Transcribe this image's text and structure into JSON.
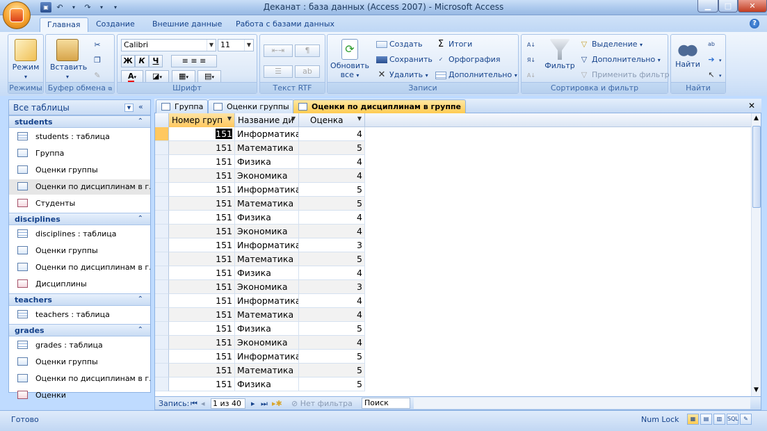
{
  "window": {
    "title": "Деканат : база данных (Access 2007)  -  Microsoft Access"
  },
  "ribbon_tabs": [
    "Главная",
    "Создание",
    "Внешние данные",
    "Работа с базами данных"
  ],
  "ribbon": {
    "groups": {
      "modes": "Режимы",
      "clipboard": "Буфер обмена",
      "font": "Шрифт",
      "rtf": "Текст RTF",
      "records": "Записи",
      "sort_filter": "Сортировка и фильтр",
      "find": "Найти"
    },
    "mode_btn": "Режим",
    "paste_btn": "Вставить",
    "font_name": "Calibri",
    "font_size": "11",
    "bold": "Ж",
    "italic": "К",
    "underline": "Ч",
    "refresh_btn": "Обновить",
    "refresh_btn2": "все",
    "new_btn": "Создать",
    "save_btn": "Сохранить",
    "delete_btn": "Удалить",
    "totals_btn": "Итоги",
    "spelling_btn": "Орфография",
    "more_btn": "Дополнительно",
    "filter_btn": "Фильтр",
    "selection_btn": "Выделение",
    "advanced_btn": "Дополнительно",
    "apply_filter_btn": "Применить фильтр",
    "find_btn": "Найти"
  },
  "nav": {
    "header": "Все таблицы",
    "sections": [
      {
        "title": "students",
        "items": [
          {
            "label": "students : таблица",
            "type": "table"
          },
          {
            "label": "Группа",
            "type": "query"
          },
          {
            "label": "Оценки группы",
            "type": "query"
          },
          {
            "label": "Оценки по дисциплинам в г...",
            "type": "query",
            "selected": true
          },
          {
            "label": "Студенты",
            "type": "form"
          }
        ]
      },
      {
        "title": "disciplines",
        "items": [
          {
            "label": "disciplines : таблица",
            "type": "table"
          },
          {
            "label": "Оценки группы",
            "type": "query"
          },
          {
            "label": "Оценки по дисциплинам в г...",
            "type": "query"
          },
          {
            "label": "Дисциплины",
            "type": "form"
          }
        ]
      },
      {
        "title": "teachers",
        "items": [
          {
            "label": "teachers : таблица",
            "type": "table"
          }
        ]
      },
      {
        "title": "grades",
        "items": [
          {
            "label": "grades : таблица",
            "type": "table"
          },
          {
            "label": "Оценки группы",
            "type": "query"
          },
          {
            "label": "Оценки по дисциплинам в г...",
            "type": "query"
          },
          {
            "label": "Оценки",
            "type": "form"
          }
        ]
      }
    ]
  },
  "doc_tabs": [
    "Группа",
    "Оценки группы",
    "Оценки по дисциплинам в группе"
  ],
  "datasheet": {
    "columns": [
      "Номер груп",
      "Название ди",
      "Оценка"
    ],
    "rows": [
      [
        "151",
        "Информатика",
        "4"
      ],
      [
        "151",
        "Математика",
        "5"
      ],
      [
        "151",
        "Физика",
        "4"
      ],
      [
        "151",
        "Экономика",
        "4"
      ],
      [
        "151",
        "Информатика",
        "5"
      ],
      [
        "151",
        "Математика",
        "5"
      ],
      [
        "151",
        "Физика",
        "4"
      ],
      [
        "151",
        "Экономика",
        "4"
      ],
      [
        "151",
        "Информатика",
        "3"
      ],
      [
        "151",
        "Математика",
        "5"
      ],
      [
        "151",
        "Физика",
        "4"
      ],
      [
        "151",
        "Экономика",
        "3"
      ],
      [
        "151",
        "Информатика",
        "4"
      ],
      [
        "151",
        "Математика",
        "4"
      ],
      [
        "151",
        "Физика",
        "5"
      ],
      [
        "151",
        "Экономика",
        "4"
      ],
      [
        "151",
        "Информатика",
        "5"
      ],
      [
        "151",
        "Математика",
        "5"
      ],
      [
        "151",
        "Физика",
        "5"
      ]
    ]
  },
  "record_nav": {
    "label": "Запись:",
    "position": "1 из 40",
    "filter": "Нет фильтра",
    "search": "Поиск"
  },
  "status": {
    "left": "Готово",
    "numlock": "Num Lock"
  }
}
